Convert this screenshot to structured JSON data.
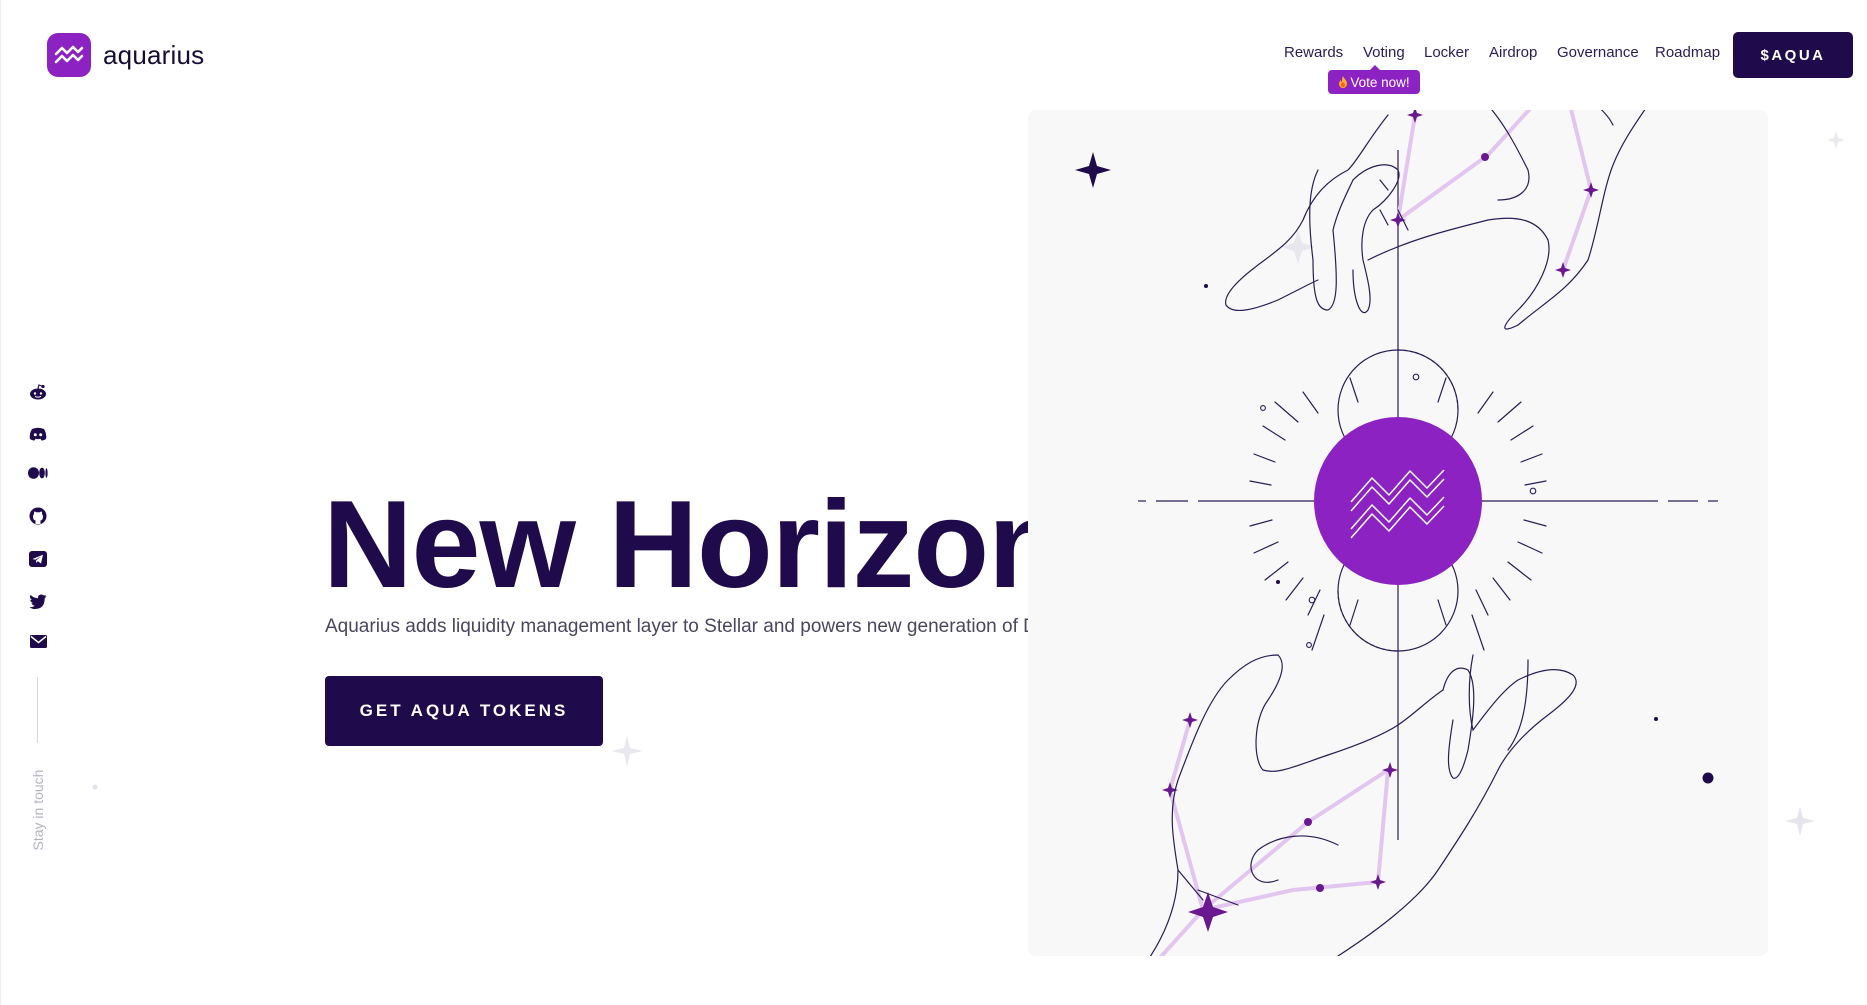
{
  "brand": {
    "name": "aquarius"
  },
  "nav": {
    "items": [
      "Rewards",
      "Voting",
      "Locker",
      "Airdrop",
      "Governance",
      "Roadmap"
    ],
    "vote_badge": "Vote now!",
    "vote_badge_icon": "fire-icon",
    "token_button": "$AQUA"
  },
  "social": {
    "icons": [
      "reddit-icon",
      "discord-icon",
      "medium-icon",
      "github-icon",
      "telegram-icon",
      "twitter-icon",
      "mail-icon"
    ],
    "label": "Stay in touch"
  },
  "hero": {
    "title": "New Horizons",
    "subtitle": "Aquarius adds liquidity management layer to Stellar and powers new generation of DeFi projects.",
    "cta": "GET AQUA TOKENS"
  },
  "colors": {
    "primary_dark": "#1f0a4b",
    "accent_purple": "#8d22c2",
    "constellation": "#e2c6ef",
    "line": "#2b1c57"
  }
}
